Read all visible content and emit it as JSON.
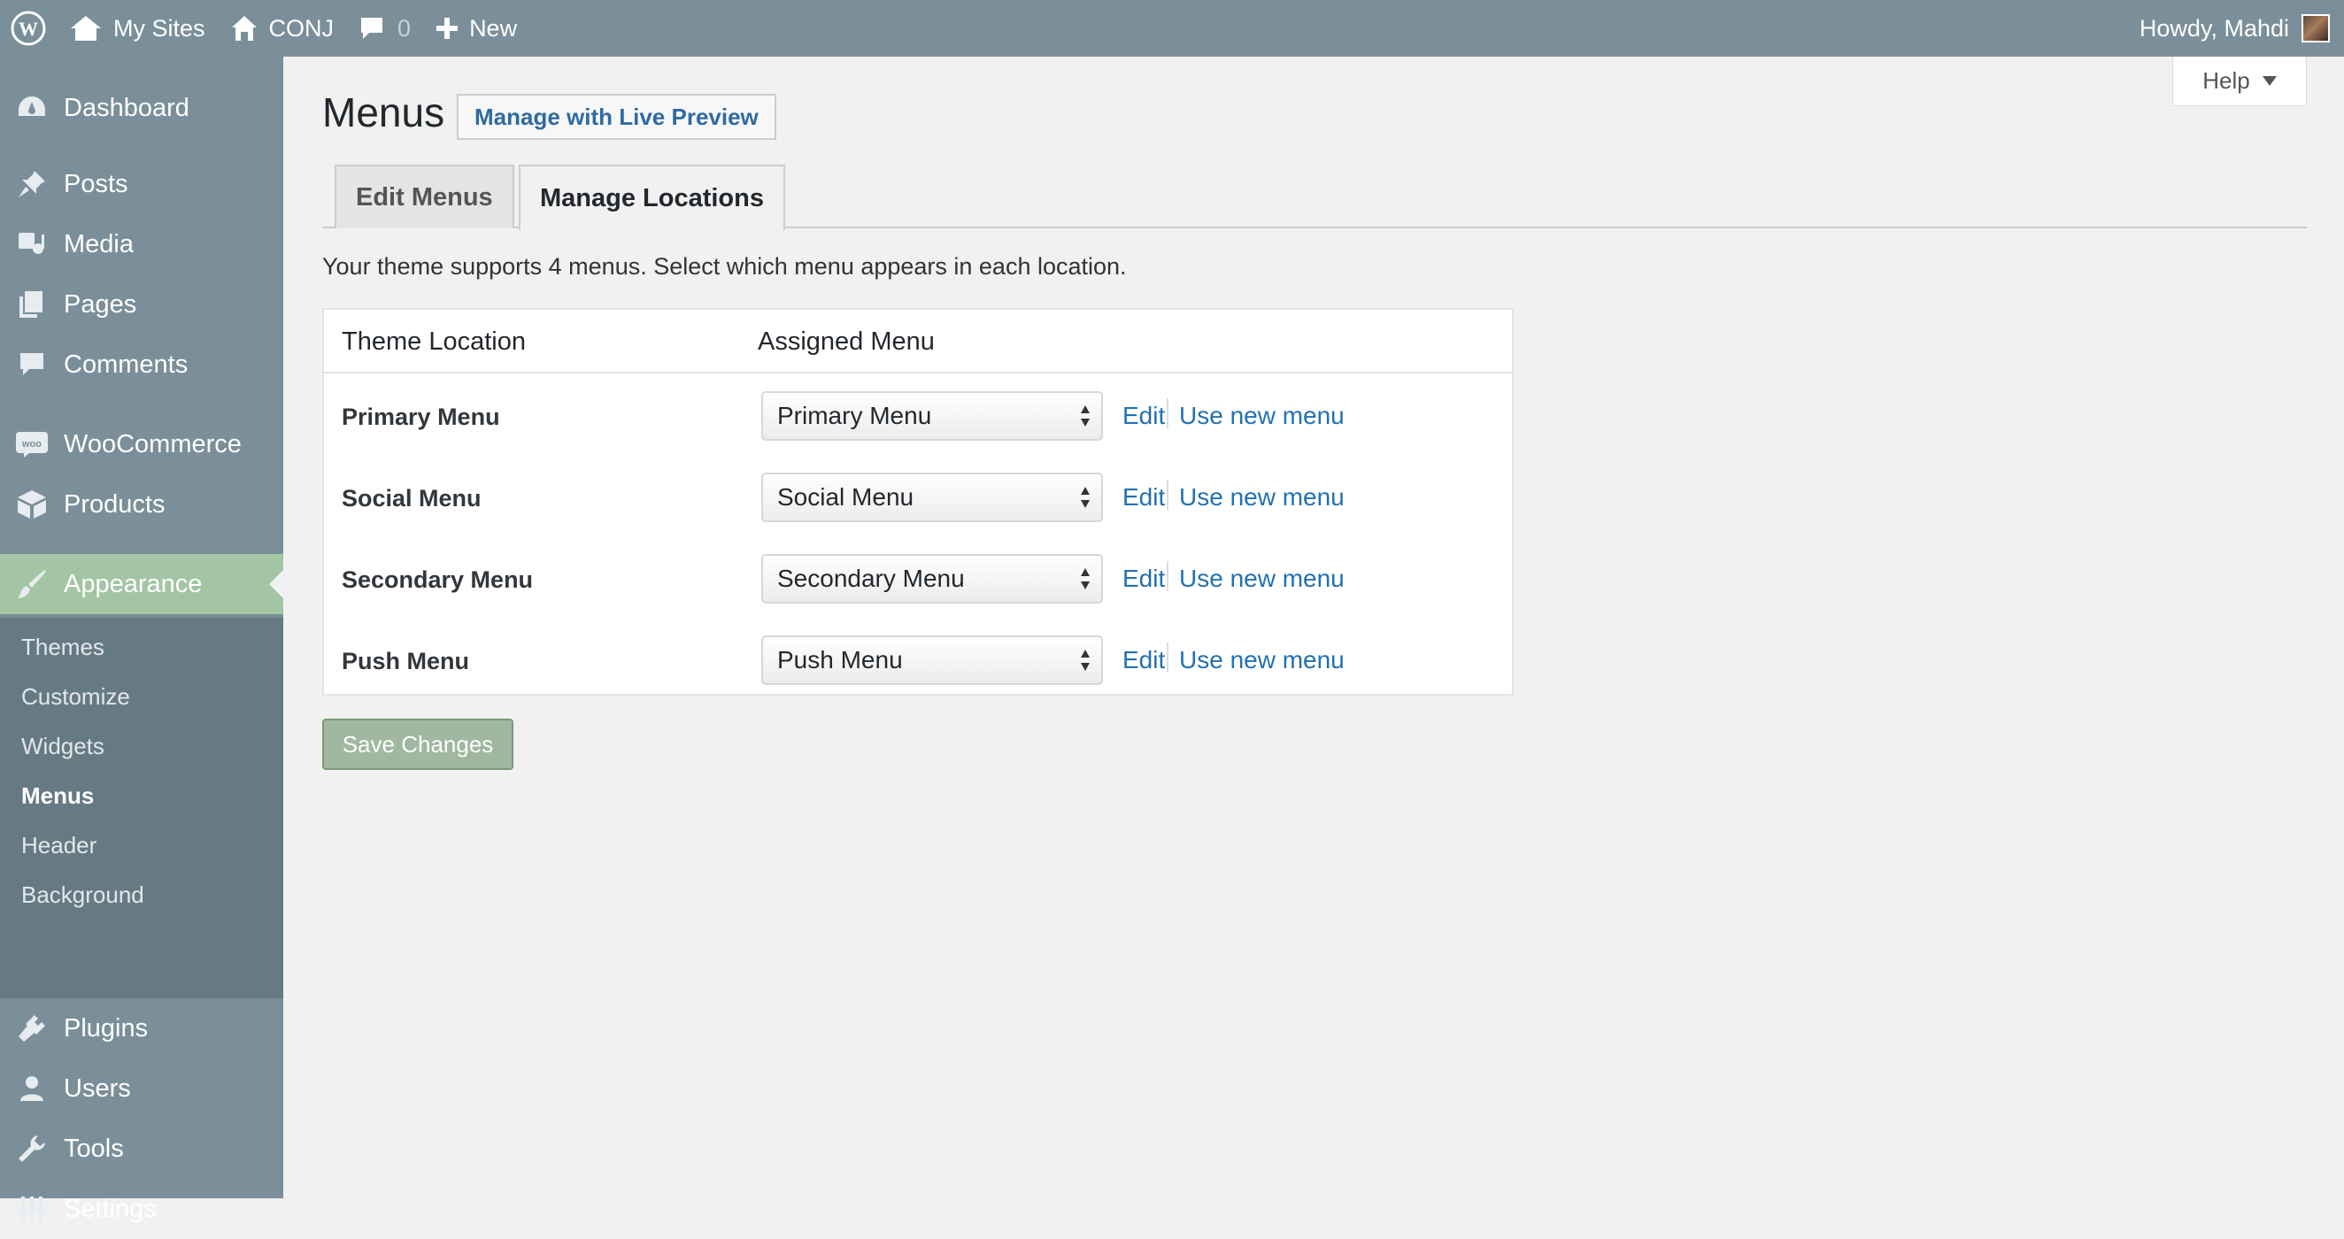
{
  "adminbar": {
    "my_sites": "My Sites",
    "site": "CONJ",
    "comments_count": "0",
    "new": "New",
    "howdy": "Howdy, Mahdi"
  },
  "sidebar": {
    "items": [
      {
        "label": "Dashboard",
        "icon": "dashboard-icon"
      },
      {
        "label": "Posts",
        "icon": "pin-icon"
      },
      {
        "label": "Media",
        "icon": "media-icon"
      },
      {
        "label": "Pages",
        "icon": "pages-icon"
      },
      {
        "label": "Comments",
        "icon": "comment-icon"
      },
      {
        "label": "WooCommerce",
        "icon": "woo-icon"
      },
      {
        "label": "Products",
        "icon": "box-icon"
      },
      {
        "label": "Appearance",
        "icon": "brush-icon"
      },
      {
        "label": "Plugins",
        "icon": "plug-icon"
      },
      {
        "label": "Users",
        "icon": "user-icon"
      },
      {
        "label": "Tools",
        "icon": "wrench-icon"
      },
      {
        "label": "Settings",
        "icon": "sliders-icon"
      }
    ],
    "submenu": [
      "Themes",
      "Customize",
      "Widgets",
      "Menus",
      "Header",
      "Background"
    ]
  },
  "main": {
    "help": "Help",
    "title": "Menus",
    "live_preview": "Manage with Live Preview",
    "tabs": [
      "Edit Menus",
      "Manage Locations"
    ],
    "intro": "Your theme supports 4 menus. Select which menu appears in each location.",
    "columns": [
      "Theme Location",
      "Assigned Menu"
    ],
    "rows": [
      {
        "location": "Primary Menu",
        "selected": "Primary Menu",
        "edit": "Edit",
        "new": "Use new menu"
      },
      {
        "location": "Social Menu",
        "selected": "Social Menu",
        "edit": "Edit",
        "new": "Use new menu"
      },
      {
        "location": "Secondary Menu",
        "selected": "Secondary Menu",
        "edit": "Edit",
        "new": "Use new menu"
      },
      {
        "location": "Push Menu",
        "selected": "Push Menu",
        "edit": "Edit",
        "new": "Use new menu"
      }
    ],
    "save": "Save Changes"
  },
  "colors": {
    "admin_bar": "#7a8f99",
    "sidebar_submenu": "#667a84",
    "current_menu": "#a3c5a3",
    "link": "#2271b1",
    "save_button": "#9fb89f"
  }
}
